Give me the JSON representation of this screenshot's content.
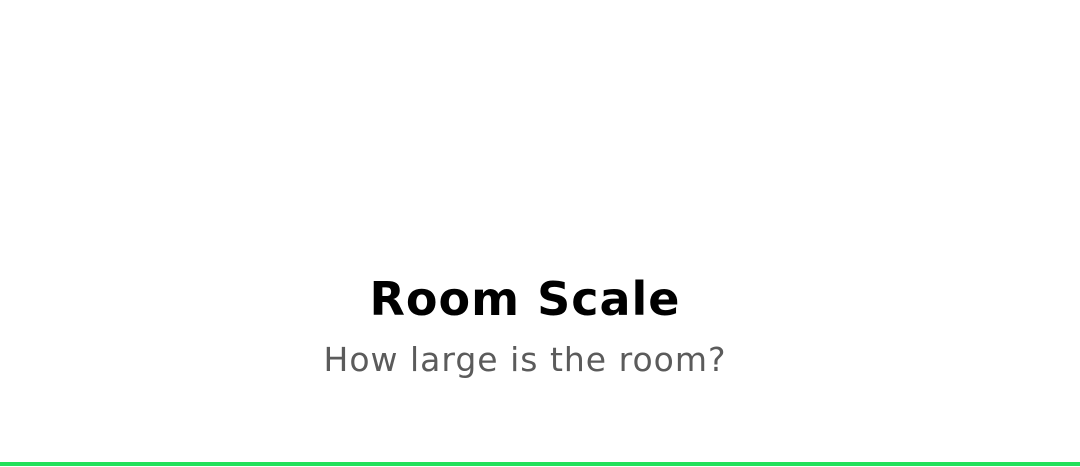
{
  "main": {
    "title": "Room Scale",
    "subtitle": "How large is the room?"
  },
  "colors": {
    "background": "#ffffff",
    "title": "#000000",
    "subtitle": "#5b5b5b",
    "accent": "#22e05a"
  }
}
